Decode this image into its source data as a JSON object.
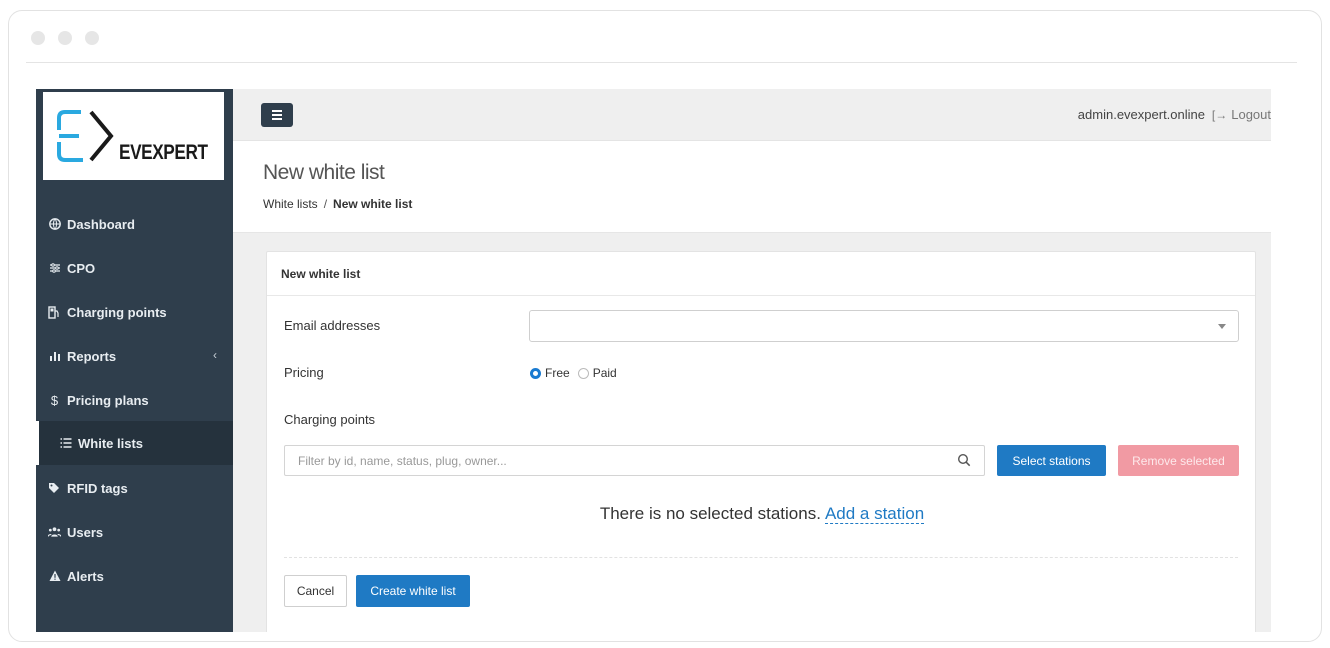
{
  "brand": {
    "name": "EVEXPERT"
  },
  "sidebar": {
    "items": [
      {
        "label": "Dashboard",
        "icon": "globe-icon"
      },
      {
        "label": "CPO",
        "icon": "sliders-icon"
      },
      {
        "label": "Charging points",
        "icon": "charging-station-icon"
      },
      {
        "label": "Reports",
        "icon": "bar-chart-icon"
      },
      {
        "label": "Pricing plans",
        "icon": "dollar-icon"
      },
      {
        "label": "White lists",
        "icon": "list-icon"
      },
      {
        "label": "RFID tags",
        "icon": "tags-icon"
      },
      {
        "label": "Users",
        "icon": "users-icon"
      },
      {
        "label": "Alerts",
        "icon": "warning-icon"
      }
    ],
    "reports_chevron": "‹"
  },
  "topbar": {
    "user": "admin.evexpert.online",
    "logout": "Logout"
  },
  "page": {
    "title": "New white list",
    "breadcrumb": {
      "parent": "White lists",
      "separator": "/",
      "current": "New white list"
    }
  },
  "form": {
    "header": "New white list",
    "email_label": "Email addresses",
    "pricing_label": "Pricing",
    "pricing_options": {
      "free": "Free",
      "paid": "Paid",
      "selected": "Free"
    },
    "charging_points_label": "Charging points",
    "filter_placeholder": "Filter by id, name, status, plug, owner...",
    "select_stations": "Select stations",
    "remove_selected": "Remove selected",
    "empty_text": "There is no selected stations.",
    "add_station": "Add a station",
    "cancel": "Cancel",
    "create": "Create white list"
  },
  "colors": {
    "sidebar": "#2f3e4c",
    "primary": "#1f7ac4",
    "danger": "#f19aa3",
    "logo_accent": "#2aa9e0"
  }
}
